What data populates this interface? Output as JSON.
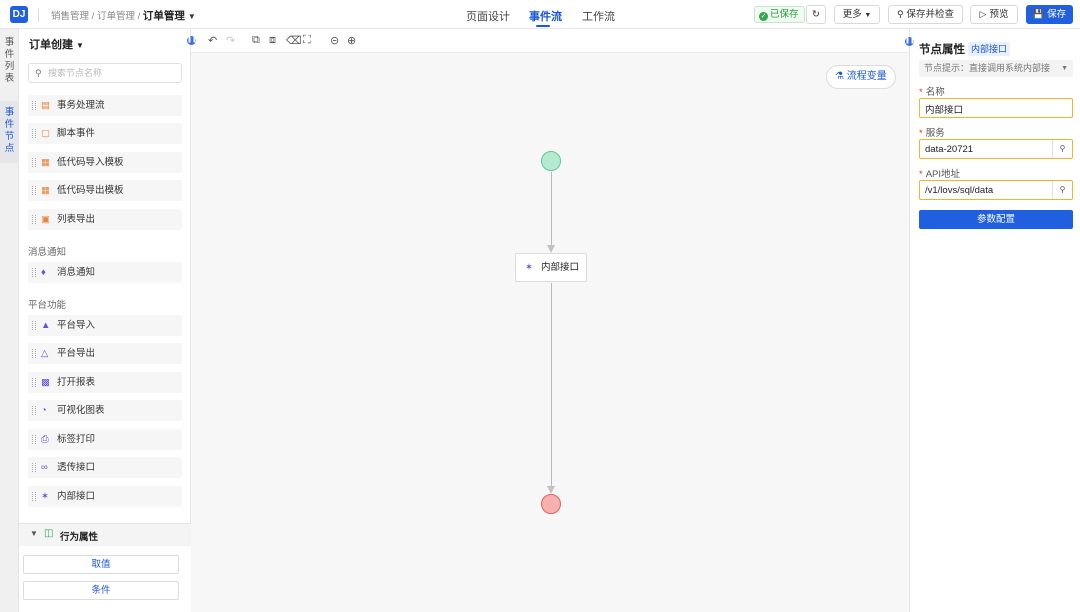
{
  "header": {
    "logo_text": "DJ",
    "breadcrumb": [
      "销售管理",
      "订单管理"
    ],
    "breadcrumb_current": "订单管理",
    "tabs": [
      {
        "label": "页面设计",
        "active": false
      },
      {
        "label": "事件流",
        "active": true
      },
      {
        "label": "工作流",
        "active": false
      }
    ],
    "saved_status": "已保存",
    "more_label": "更多",
    "save_check_label": "保存并检查",
    "preview_label": "预览",
    "save_label": "保存"
  },
  "side_tabs": [
    {
      "label": "事件列表",
      "active": false
    },
    {
      "label": "事件节点",
      "active": true
    }
  ],
  "node_panel": {
    "title": "订单创建",
    "search_placeholder": "搜索节点名称",
    "items": [
      {
        "label": "事务处理流",
        "icon": "workflow-icon",
        "color": "orange"
      },
      {
        "label": "脚本事件",
        "icon": "script-icon",
        "color": "orange"
      },
      {
        "label": "低代码导入模板",
        "icon": "import-template-icon",
        "color": "orange"
      },
      {
        "label": "低代码导出模板",
        "icon": "export-template-icon",
        "color": "orange"
      },
      {
        "label": "列表导出",
        "icon": "list-export-icon",
        "color": "orange"
      }
    ],
    "section_message": "消息通知",
    "message_items": [
      {
        "label": "消息通知",
        "icon": "bell-icon",
        "color": "purple"
      }
    ],
    "section_platform": "平台功能",
    "platform_items": [
      {
        "label": "平台导入",
        "icon": "import-icon",
        "color": "purple"
      },
      {
        "label": "平台导出",
        "icon": "export-icon",
        "color": "purple"
      },
      {
        "label": "打开报表",
        "icon": "report-icon",
        "color": "purple"
      },
      {
        "label": "可视化图表",
        "icon": "pie-chart-icon",
        "color": "purple"
      },
      {
        "label": "标签打印",
        "icon": "printer-icon",
        "color": "purple"
      },
      {
        "label": "透传接口",
        "icon": "link-icon",
        "color": "purple"
      },
      {
        "label": "内部接口",
        "icon": "plug-icon",
        "color": "purple"
      }
    ],
    "behavior_title": "行为属性",
    "behavior_buttons": [
      "取值",
      "条件"
    ]
  },
  "canvas": {
    "flow_vars_label": "流程变量",
    "process_node_label": "内部接口"
  },
  "properties": {
    "title": "节点属性",
    "tag": "内部接口",
    "hint": "节点提示：直接调用系统内部接",
    "fields": [
      {
        "label": "名称",
        "value": "内部接口",
        "has_addon": false
      },
      {
        "label": "服务",
        "value": "data-20721",
        "has_addon": true
      },
      {
        "label": "API地址",
        "value": "/v1/lovs/sql/data",
        "has_addon": true
      }
    ],
    "config_button": "参数配置"
  },
  "colors": {
    "primary": "#1f5fe0",
    "accent_orange": "#e8853a",
    "accent_purple": "#6c4fd6",
    "success": "#2fa84f",
    "start_node": "#b6ead0",
    "end_node": "#f7b0b0",
    "field_border": "#f0b52e"
  }
}
